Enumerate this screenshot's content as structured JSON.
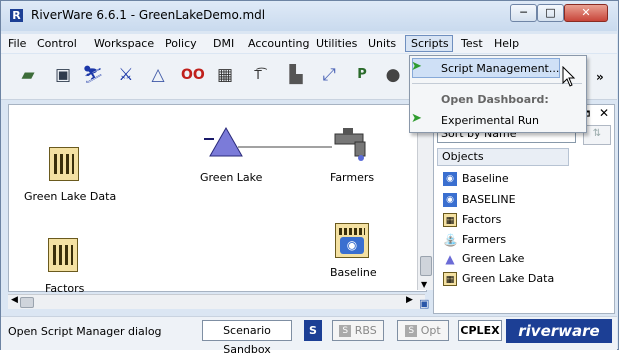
{
  "window": {
    "title": "RiverWare 6.6.1 - GreenLakeDemo.mdl",
    "logo_letter": "R",
    "min_glyph": "─",
    "max_glyph": "□",
    "close_glyph": "✕"
  },
  "menubar": {
    "items": [
      "File",
      "Control",
      "Workspace",
      "Policy",
      "DMI",
      "Accounting",
      "Utilities",
      "Units",
      "Scripts",
      "Test",
      "Help"
    ]
  },
  "scripts_menu": {
    "script_management": "Script Management...",
    "section_header": "Open Dashboard:",
    "experimental_run": "Experimental Run"
  },
  "toolbar": {
    "more": "»"
  },
  "workspace": {
    "objects": [
      {
        "label": "Green Lake Data"
      },
      {
        "label": "Green Lake"
      },
      {
        "label": "Farmers"
      },
      {
        "label": "Factors"
      },
      {
        "label": "Baseline"
      }
    ]
  },
  "right_panel": {
    "sort_by": "Sort by Name",
    "objects_header": "Objects",
    "items": [
      "Baseline",
      "BASELINE",
      "Factors",
      "Farmers",
      "Green Lake",
      "Green Lake Data"
    ]
  },
  "statusbar": {
    "message": "Open Script Manager dialog",
    "scenario_button": "Scenario Sandbox",
    "s_badge": "S",
    "rbs_label": "RBS",
    "opt_label": "Opt",
    "cplex": "CPLEX",
    "brand": "riverware"
  },
  "colors": {
    "accent_blue": "#1c3f95",
    "menu_highlight": "#d8e4f4",
    "green_arrow": "#2e9c2e"
  }
}
